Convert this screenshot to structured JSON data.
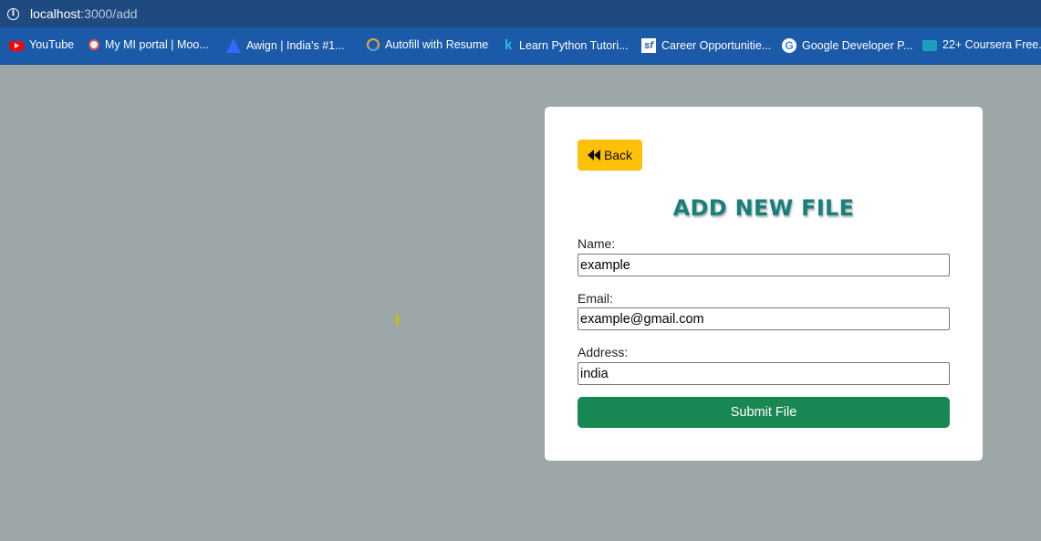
{
  "browser": {
    "url_host": "localhost",
    "url_path": ":3000/add",
    "bookmarks": [
      {
        "label": "YouTube",
        "icon": "youtube-icon"
      },
      {
        "label": "My MI portal | Moo...",
        "icon": "moodle-icon"
      },
      {
        "label": "Awign | India's #1...",
        "icon": "awign-icon"
      },
      {
        "label": "Autofill with Resume",
        "icon": "autofill-icon"
      },
      {
        "label": "Learn Python Tutori...",
        "icon": "learnpython-icon"
      },
      {
        "label": "Career Opportunitie...",
        "icon": "career-icon"
      },
      {
        "label": "Google Developer P...",
        "icon": "google-icon"
      },
      {
        "label": "22+ Coursera Free...",
        "icon": "coursera-icon"
      }
    ]
  },
  "form": {
    "back_label": "Back",
    "title": "ADD NEW FILE",
    "name_label": "Name:",
    "name_value": "example",
    "email_label": "Email:",
    "email_value": "example@gmail.com",
    "address_label": "Address:",
    "address_value": "india",
    "submit_label": "Submit File"
  },
  "colors": {
    "page_bg": "#9ea7a7",
    "back_button": "#ffc107",
    "title": "#17807a",
    "submit_button": "#198754"
  }
}
